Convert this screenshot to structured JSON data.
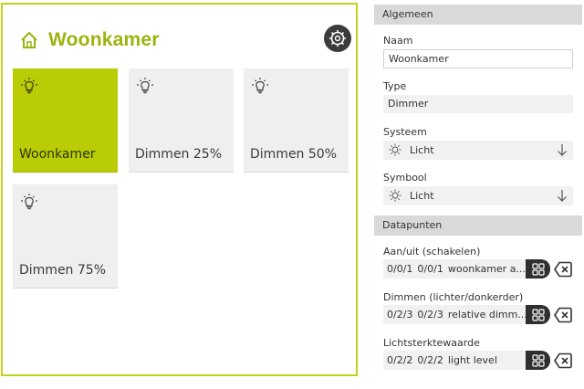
{
  "room": {
    "title": "Woonkamer",
    "home_icon": "home-icon",
    "settings_icon": "gear-icon",
    "tiles": [
      {
        "label": "Woonkamer",
        "icon": "bulb-icon",
        "active": true
      },
      {
        "label": "Dimmen 25%",
        "icon": "bulb-icon",
        "active": false
      },
      {
        "label": "Dimmen 50%",
        "icon": "bulb-icon",
        "active": false
      },
      {
        "label": "Dimmen 75%",
        "icon": "bulb-icon",
        "active": false
      }
    ],
    "accent_color": "#b9cc06",
    "title_color": "#9bb40d"
  },
  "properties": {
    "general": {
      "header": "Algemeen",
      "name_label": "Naam",
      "name_value": "Woonkamer",
      "type_label": "Type",
      "type_value": "Dimmer",
      "system_label": "Systeem",
      "system_value": "Licht",
      "symbol_label": "Symbool",
      "symbol_value": "Licht"
    },
    "datapoints": {
      "header": "Datapunten",
      "items": [
        {
          "label": "Aan/uit (schakelen)",
          "addr1": "0/0/1",
          "addr2": "0/0/1",
          "name": "woonkamer a..."
        },
        {
          "label": "Dimmen (lichter/donkerder)",
          "addr1": "0/2/3",
          "addr2": "0/2/3",
          "name": "relative dimm..."
        },
        {
          "label": "Lichtsterktewaarde",
          "addr1": "0/2/2",
          "addr2": "0/2/2",
          "name": "light level"
        }
      ]
    }
  }
}
